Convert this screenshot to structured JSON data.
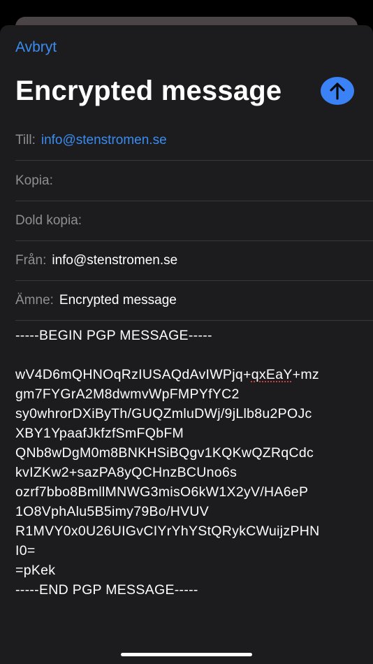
{
  "header": {
    "cancel_label": "Avbryt",
    "title": "Encrypted message",
    "send_icon": "arrow-up-icon",
    "accent_color": "#3a82f6"
  },
  "fields": {
    "to": {
      "label": "Till:",
      "value": "info@stenstromen.se"
    },
    "cc": {
      "label": "Kopia:",
      "value": ""
    },
    "bcc": {
      "label": "Dold kopia:",
      "value": ""
    },
    "from": {
      "label": "Från:",
      "value": "info@stenstromen.se"
    },
    "subject": {
      "label": "Ämne:",
      "value": "Encrypted message"
    }
  },
  "body": {
    "begin": "-----BEGIN PGP MESSAGE-----",
    "line1_a": "wV4D6mQHNOqRzIUSAQdAvIWPjq+",
    "line1_b": "qxEaY",
    "line1_c": "+mz",
    "lines": [
      "gm7FYGrA2M8dwmvWpFMPYfYC2",
      "sy0whrorDXiByTh/GUQZmluDWj/9jLlb8u2POJc",
      "XBY1YpaafJkfzfSmFQbFM",
      "QNb8wDgM0m8BNKHSiBQgv1KQKwQZRqCdc",
      "kvIZKw2+sazPA8yQCHnzBCUno6s",
      "ozrf7bbo8BmllMNWG3misO6kW1X2yV/HA6eP",
      "1O8VphAlu5B5imy79Bo/HVUV",
      "R1MVY0x0U26UIGvCIYrYhYStQRykCWuijzPHN",
      "I0=",
      "=pKek"
    ],
    "end": "-----END PGP MESSAGE-----"
  }
}
